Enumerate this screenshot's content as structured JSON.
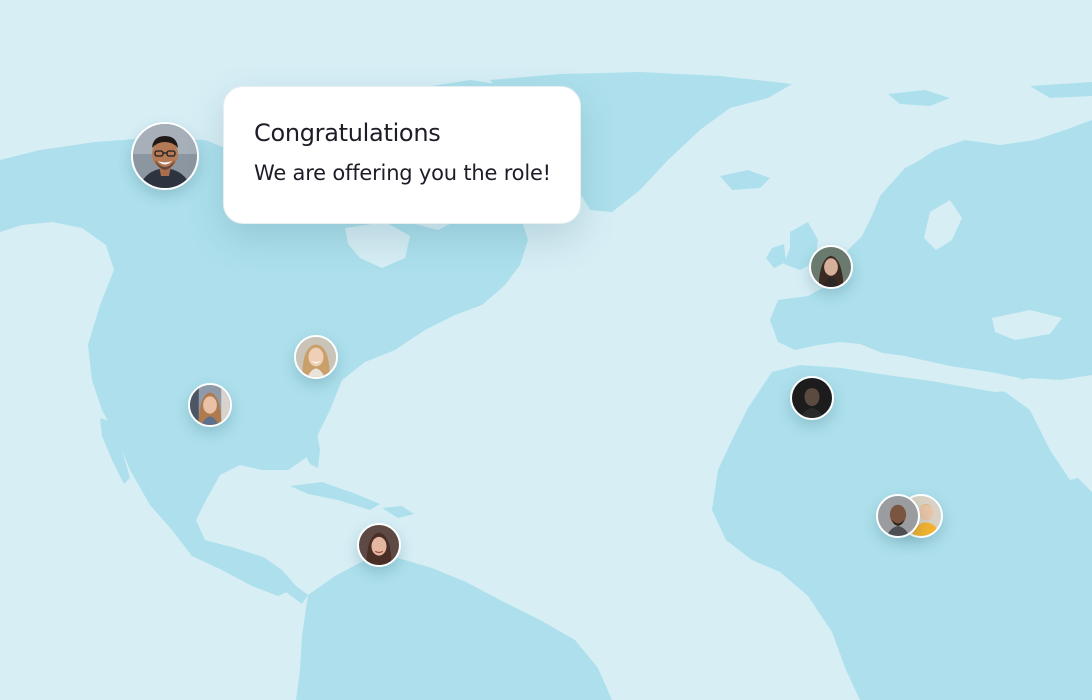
{
  "map": {
    "background_color": "#d7eef5",
    "land_color": "#ade0ec"
  },
  "message": {
    "title": "Congratulations",
    "text": "We are offering you the role!"
  },
  "avatars": [
    {
      "name": "recruiter-avatar-icon",
      "description": "man with glasses"
    },
    {
      "name": "person-avatar-icon",
      "description": "woman with long hair"
    },
    {
      "name": "person-avatar-icon",
      "description": "woman smiling"
    },
    {
      "name": "person-avatar-icon",
      "description": "woman with braid"
    },
    {
      "name": "person-avatar-icon",
      "description": "woman looking aside"
    },
    {
      "name": "person-avatar-icon",
      "description": "man in dark portrait"
    },
    {
      "name": "person-avatar-icon",
      "description": "bald man"
    },
    {
      "name": "person-avatar-icon",
      "description": "person in yellow"
    }
  ]
}
